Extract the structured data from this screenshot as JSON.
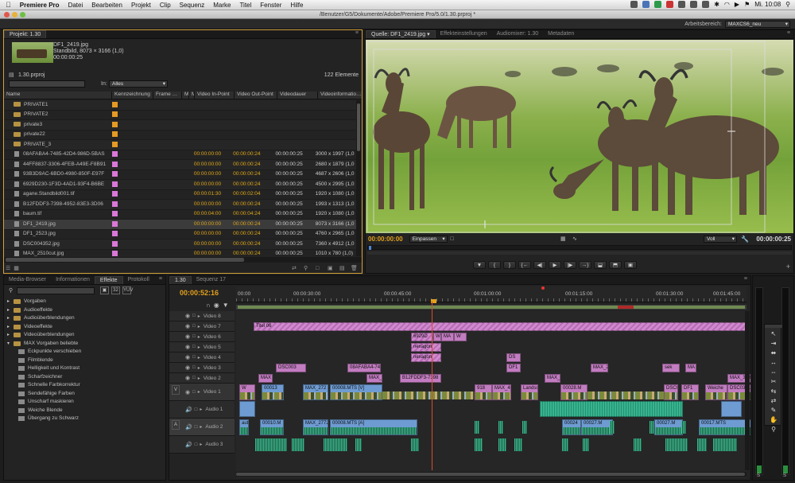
{
  "menubar": {
    "apple": "",
    "app_name": "Premiere Pro",
    "items": [
      "Datei",
      "Bearbeiten",
      "Projekt",
      "Clip",
      "Sequenz",
      "Marke",
      "Titel",
      "Fenster",
      "Hilfe"
    ],
    "clock": "Mi. 10:08"
  },
  "window": {
    "title": "/Benutzer/G5/Dokumente/Adobe/Premiere Pro/5.0/1.30.prproj *"
  },
  "workspace": {
    "label": "Arbeitsbereich:",
    "value": "MAXCS6_neu"
  },
  "project": {
    "tab": "Projekt: 1.30",
    "preview": {
      "name": "DF1_2419.jpg",
      "type": "Standbild, 8073 × 3166 (1,0)",
      "duration": "00:00:00:25"
    },
    "file": "1.30.prproj",
    "count": "122 Elemente",
    "search_placeholder": "",
    "in_label": "In:",
    "in_value": "Alles",
    "columns": [
      "Name",
      "Kennzeichnung",
      "Frame Media",
      "Med",
      "Me",
      "Video In-Point",
      "Video Out-Point",
      "Videodauer",
      "Videoinformationen"
    ],
    "rows": [
      {
        "kind": "folder",
        "name": "PRIVATE1",
        "color": "#e49a24",
        "in": "",
        "out": "",
        "dur": "",
        "info": ""
      },
      {
        "kind": "folder",
        "name": "PRIVATE2",
        "color": "#e49a24",
        "in": "",
        "out": "",
        "dur": "",
        "info": ""
      },
      {
        "kind": "folder",
        "name": "private3",
        "color": "#e49a24",
        "in": "",
        "out": "",
        "dur": "",
        "info": ""
      },
      {
        "kind": "folder",
        "name": "private22",
        "color": "#e49a24",
        "in": "",
        "out": "",
        "dur": "",
        "info": ""
      },
      {
        "kind": "folder",
        "name": "PRIVATE_3",
        "color": "#e49a24",
        "in": "",
        "out": "",
        "dur": "",
        "info": ""
      },
      {
        "kind": "file",
        "name": "08AFABA4-7485-42D4-986D-5BAS",
        "color": "#d978d8",
        "in": "00:00:00:00",
        "out": "00:00:00:24",
        "dur": "00:00:00:25",
        "info": "3000 x 1997 (1,0"
      },
      {
        "kind": "file",
        "name": "44FF8837-3306-4FEB-A49E-F8B91",
        "color": "#d978d8",
        "in": "00:00:00:00",
        "out": "00:00:00:24",
        "dur": "00:00:00:25",
        "info": "2680 x 1879 (1,0"
      },
      {
        "kind": "file",
        "name": "93B3D9AC-6BD0-4980-850F-E97F",
        "color": "#d978d8",
        "in": "00:00:00:00",
        "out": "00:00:00:24",
        "dur": "00:00:00:25",
        "info": "4687 x 2606 (1,0"
      },
      {
        "kind": "file",
        "name": "6929D230-1F3D-4AD1-93F4-B6BE",
        "color": "#d978d8",
        "in": "00:00:00:00",
        "out": "00:00:00:24",
        "dur": "00:00:00:25",
        "info": "4500 x 2995 (1,0"
      },
      {
        "kind": "file",
        "name": "agane.Standbild001.tif",
        "color": "#d978d8",
        "in": "00:00:01:30",
        "out": "00:00:02:04",
        "dur": "00:00:00:25",
        "info": "1920 x 1080 (1,0"
      },
      {
        "kind": "file",
        "name": "B12FDDF3-7398-4952-83E3-3D06",
        "color": "#d978d8",
        "in": "00:00:00:00",
        "out": "00:00:00:24",
        "dur": "00:00:00:25",
        "info": "1993 x 1313 (1,0"
      },
      {
        "kind": "file",
        "name": "baum.tif",
        "color": "#d978d8",
        "in": "00:00:04:00",
        "out": "00:00:04:24",
        "dur": "00:00:00:25",
        "info": "1920 x 1080 (1,0"
      },
      {
        "kind": "file",
        "name": "DF1_2419.jpg",
        "color": "#d978d8",
        "in": "00:00:00:00",
        "out": "00:00:00:24",
        "dur": "00:00:00:25",
        "info": "8073 x 3166 (1,0",
        "selected": true
      },
      {
        "kind": "file",
        "name": "DF1_2523.jpg",
        "color": "#d978d8",
        "in": "00:00:00:00",
        "out": "00:00:00:24",
        "dur": "00:00:00:25",
        "info": "4760 x 2965 (1,0"
      },
      {
        "kind": "file",
        "name": "DSC004352.jpg",
        "color": "#d978d8",
        "in": "00:00:00:00",
        "out": "00:00:00:24",
        "dur": "00:00:00:25",
        "info": "7360 x 4912 (1,0"
      },
      {
        "kind": "file",
        "name": "MAX_2510cut.jpg",
        "color": "#d978d8",
        "in": "00:00:00:00",
        "out": "00:00:00:24",
        "dur": "00:00:00:25",
        "info": "1010 x 780 (1,0)"
      }
    ]
  },
  "source": {
    "tabs": [
      "Quelle: DF1_2419.jpg",
      "Effekteinstellungen",
      "Audiomixer: 1.30",
      "Metadaten"
    ],
    "timecode_in": "00:00:00:00",
    "fit": "Einpassen",
    "quality": "Voll",
    "timecode_out": "00:00:00:25"
  },
  "effects": {
    "tabs": [
      "Media-Browser",
      "Informationen",
      "Effekte",
      "Protokoll"
    ],
    "tree": [
      {
        "label": "Vorgaben",
        "level": 0
      },
      {
        "label": "Audioeffekte",
        "level": 0
      },
      {
        "label": "Audioüberblendungen",
        "level": 0
      },
      {
        "label": "Videoeffekte",
        "level": 0
      },
      {
        "label": "Videoüberblendungen",
        "level": 0
      },
      {
        "label": "MAX Vorgaben beliebte",
        "level": 0,
        "open": true
      },
      {
        "label": "Eckpunkte verschieben",
        "level": 1
      },
      {
        "label": "Filmblende",
        "level": 1
      },
      {
        "label": "Helligkeit und Kontrast",
        "level": 1
      },
      {
        "label": "Scharfzeichner",
        "level": 1
      },
      {
        "label": "Schnelle Farbkorrektur",
        "level": 1
      },
      {
        "label": "Sendefähige Farben",
        "level": 1
      },
      {
        "label": "Unscharf maskieren",
        "level": 1
      },
      {
        "label": "Weiche Blende",
        "level": 1
      },
      {
        "label": "Übergang zu Schwarz",
        "level": 1
      }
    ]
  },
  "timeline": {
    "tabs": [
      "1.30",
      "Sequenz 17"
    ],
    "timecode": "00:00:52:16",
    "ruler": [
      "00:00",
      "00:00:30:00",
      "00:00:45:00",
      "00:01:00:00",
      "00:01:15:00",
      "00:01:30:00",
      "00:01:45:00"
    ],
    "tracks": [
      "Video 8",
      "Video 7",
      "Video 6",
      "Video 5",
      "Video 4",
      "Video 3",
      "Video 2",
      "Video 1",
      "Audio 1",
      "Audio 2",
      "Audio 3"
    ],
    "clips": {
      "v7": "Titel 06",
      "v6": "6929D",
      "v6b": "W",
      "v6c": "MA",
      "v6d": "W",
      "v5": "nexagon",
      "v4": "nexagon",
      "v4b": "DS",
      "v3a": "DSC003",
      "v3b": "08AFABA4-74E",
      "v3c": "DF1",
      "v3d": "MAX_2",
      "v3e": "sek",
      "v3f": "MA",
      "v2a": "MAX",
      "v2b": "MAX_",
      "v2c": "B12FDDF3-7398",
      "v2d": "MAX_",
      "v2e": "MAX_3787-2.",
      "v1a": "W",
      "v1b": "00013",
      "v1c": "MAX_272",
      "v1d": "00008.MTS [V]",
      "v1e": "918",
      "v1f": "MAX_4050",
      "v1g": "Landsc",
      "v1h": "00028.M",
      "v1i": "DSC0",
      "v1j": "DF1",
      "v1k": "Weiche",
      "v1l": "DSC03911-4.jp",
      "v1m": "P10",
      "a2a": "auto",
      "a2b": "00010.M",
      "a2c": "MAX_2772.M",
      "a2d": "00008.MTS [A]",
      "a2e": "00024",
      "a2f": "00027.M",
      "a2g": "00027.M",
      "a2h": "00017.MTS"
    }
  },
  "tools": [
    "selection-tool",
    "track-select-tool",
    "ripple-tool",
    "rolling-tool",
    "rate-stretch-tool",
    "razor-tool",
    "slip-tool",
    "slide-tool",
    "pen-tool",
    "hand-tool",
    "zoom-tool"
  ],
  "meter": {
    "labels": [
      "S",
      "S"
    ]
  }
}
